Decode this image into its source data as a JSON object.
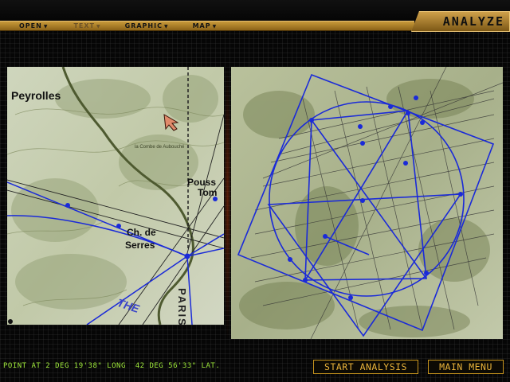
{
  "header": {
    "title": "ANALYZE"
  },
  "menu": [
    {
      "label": "OPEN",
      "enabled": true
    },
    {
      "label": "TEXT",
      "enabled": false
    },
    {
      "label": "GRAPHIC",
      "enabled": true
    },
    {
      "label": "MAP",
      "enabled": true
    }
  ],
  "left_map": {
    "labels": {
      "town_peyrolles": "Peyrolles",
      "place_combe": "la Combe de Aubouché",
      "town_pouss": "Pouss",
      "town_tom": "Tom",
      "place_ch_de": "Ch. de",
      "place_serres": "Serres",
      "road_paris": "PARIS",
      "road_the": "THE"
    }
  },
  "status": {
    "text": "POINT AT 2 DEG 19'38\" LONG  42 DEG 56'33\" LAT."
  },
  "buttons": {
    "start_analysis": "START ANALYSIS",
    "main_menu": "MAIN MENU"
  },
  "colors": {
    "menu_bar": "#b78a30",
    "status_text": "#9ee83a",
    "button_text": "#e8b23a",
    "overlay_line": "#1a2ad8",
    "map_base": "#c9d0b4"
  }
}
